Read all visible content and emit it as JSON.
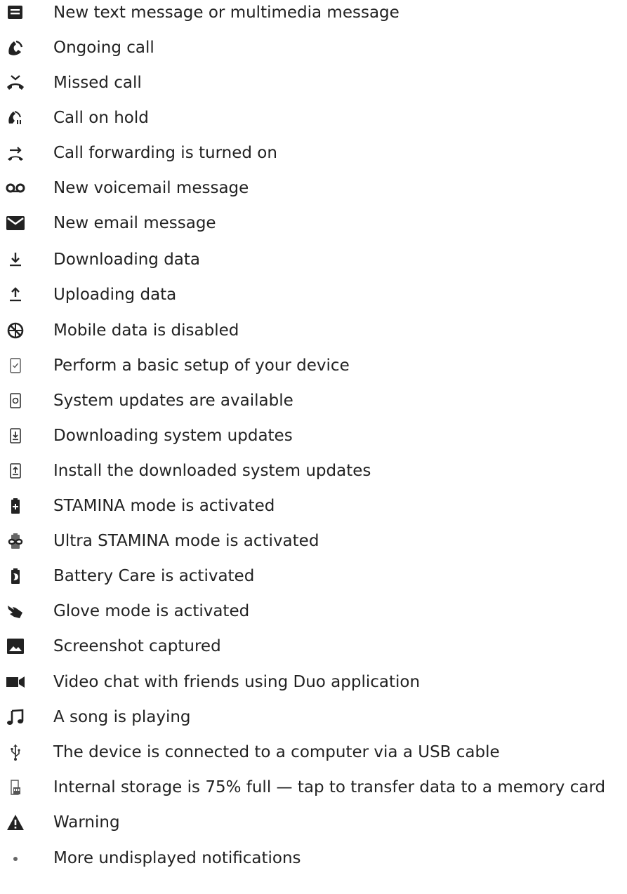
{
  "colors": {
    "text": "#222222",
    "icon": "#222222",
    "icon_light": "#555555"
  },
  "items": [
    {
      "icon": "message-icon",
      "label": "New text message or multimedia message"
    },
    {
      "icon": "ongoing-call-icon",
      "label": "Ongoing call"
    },
    {
      "icon": "missed-call-icon",
      "label": "Missed call"
    },
    {
      "icon": "call-hold-icon",
      "label": "Call on hold"
    },
    {
      "icon": "call-forward-icon",
      "label": "Call forwarding is turned on"
    },
    {
      "icon": "voicemail-icon",
      "label": "New voicemail message"
    },
    {
      "icon": "email-icon",
      "label": "New email message"
    },
    {
      "icon": "download-icon",
      "label": "Downloading data"
    },
    {
      "icon": "upload-icon",
      "label": "Uploading data"
    },
    {
      "icon": "mobile-data-disabled-icon",
      "label": "Mobile data is disabled"
    },
    {
      "icon": "setup-icon",
      "label": "Perform a basic setup of your device"
    },
    {
      "icon": "system-update-icon",
      "label": "System updates are available"
    },
    {
      "icon": "system-update-download-icon",
      "label": "Downloading system updates"
    },
    {
      "icon": "system-update-install-icon",
      "label": "Install the downloaded system updates"
    },
    {
      "icon": "stamina-icon",
      "label": "STAMINA mode is activated"
    },
    {
      "icon": "ultra-stamina-icon",
      "label": "Ultra STAMINA mode is activated"
    },
    {
      "icon": "battery-care-icon",
      "label": "Battery Care is activated"
    },
    {
      "icon": "glove-mode-icon",
      "label": "Glove mode is activated"
    },
    {
      "icon": "screenshot-icon",
      "label": "Screenshot captured"
    },
    {
      "icon": "video-chat-icon",
      "label": "Video chat with friends using Duo application"
    },
    {
      "icon": "music-note-icon",
      "label": "A song is playing"
    },
    {
      "icon": "usb-icon",
      "label": "The device is connected to a computer via a USB cable"
    },
    {
      "icon": "storage-icon",
      "label": "Internal storage is 75% full — tap to transfer data to a memory card"
    },
    {
      "icon": "warning-icon",
      "label": "Warning"
    },
    {
      "icon": "more-notifications-icon",
      "label": "More undisplayed notifications"
    }
  ]
}
